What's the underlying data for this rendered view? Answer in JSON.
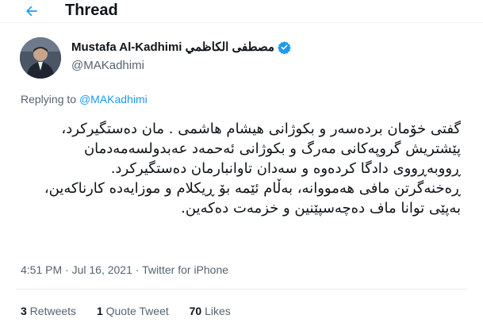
{
  "header": {
    "title": "Thread"
  },
  "author": {
    "name": "Mustafa Al-Kadhimi مصطفى الكاظمي",
    "handle": "@MAKadhimi",
    "verified_color": "#1d9bf0"
  },
  "reply": {
    "prefix": "Replying to ",
    "handle": "@MAKadhimi"
  },
  "tweet": {
    "paragraph1": "گفتی خۆمان بردەسەر و بکوژانی هیشام هاشمی . مان دەستگیرکرد، پێشتریش گروپەکانی مەرگ و بکوژانی ئەحمەد عەبدولسەمەدمان ڕووبەڕووی دادگا کردەوە و سەدان تاوانبارمان دەستگیرکرد.",
    "paragraph2": "ڕەخنەگرتن مافی هەمووانە، بەڵام ئێمە بۆ ڕیکلام و موزایەدە کارناکەین، بەپێی توانا ماف دەچەسپێنین و خزمەت دەکەین."
  },
  "meta": {
    "time": "4:51 PM",
    "sep": " · ",
    "date": "Jul 16, 2021",
    "source": "Twitter for iPhone"
  },
  "stats": {
    "retweets_count": "3",
    "retweets_label": " Retweets",
    "quotes_count": "1",
    "quotes_label": " Quote Tweet",
    "likes_count": "70",
    "likes_label": " Likes"
  }
}
